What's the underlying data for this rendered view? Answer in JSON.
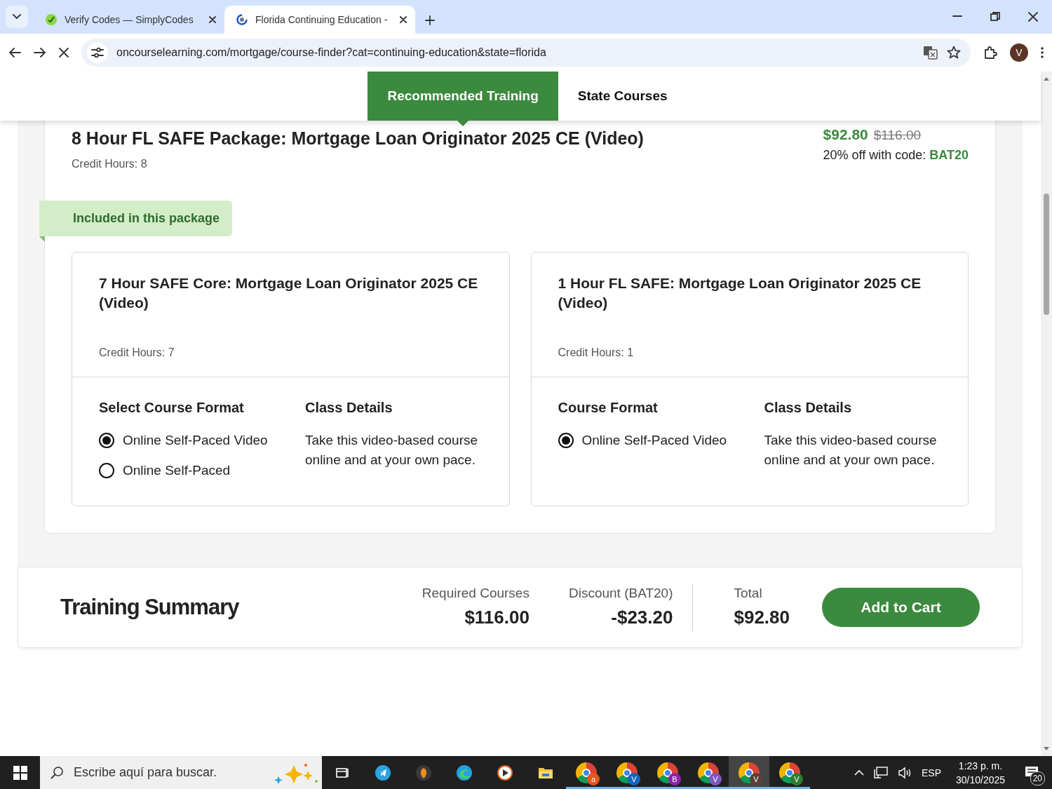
{
  "browser": {
    "tabs": [
      {
        "title": "Verify Codes — SimplyCodes",
        "kind": "simplycodes",
        "selected": false
      },
      {
        "title": "Florida Continuing Education - ",
        "kind": "loading",
        "selected": true
      }
    ],
    "url": "oncourselearning.com/mortgage/course-finder?cat=continuing-education&state=florida",
    "profile_initial": "V"
  },
  "page_nav": [
    {
      "label": "Recommended Training",
      "selected": true
    },
    {
      "label": "State Courses",
      "selected": false
    }
  ],
  "package": {
    "title": "8 Hour FL SAFE Package: Mortgage Loan Originator 2025 CE (Video)",
    "credit_hours": "Credit Hours: 8",
    "price": "$92.80",
    "original_price": "$116.00",
    "discount_text": "20% off with code: **BAT20**",
    "included_label": "Included in this package",
    "courses": [
      {
        "title": "7 Hour SAFE Core: Mortgage Loan Originator 2025 CE (Video)",
        "credit_hours": "Credit Hours: 7",
        "format_heading": "Select Course Format",
        "formats": [
          {
            "label": "Online Self-Paced Video",
            "selected": true
          },
          {
            "label": "Online Self-Paced",
            "selected": false
          }
        ],
        "details_heading": "Class Details",
        "details": "Take this video-based course online and at your own pace."
      },
      {
        "title": "1 Hour FL SAFE: Mortgage Loan Originator 2025 CE (Video)",
        "credit_hours": "Credit Hours: 1",
        "format_heading": "Course Format",
        "formats": [
          {
            "label": "Online Self-Paced Video",
            "selected": true
          }
        ],
        "details_heading": "Class Details",
        "details": "Take this video-based course online and at your own pace."
      }
    ]
  },
  "summary": {
    "title": "Training Summary",
    "items": [
      {
        "label": "Required Courses",
        "value": "$116.00"
      },
      {
        "label": "Discount (BAT20)",
        "value": "-$23.20"
      },
      {
        "label": "Total",
        "value": "$92.80"
      }
    ],
    "button": "Add to Cart"
  },
  "taskbar": {
    "search_placeholder": "Escribe aquí para buscar.",
    "apps": [
      {
        "kind": "task-view",
        "running": false,
        "selected": false
      },
      {
        "kind": "telegram",
        "running": false,
        "selected": false
      },
      {
        "kind": "fl-studio",
        "running": false,
        "selected": false
      },
      {
        "kind": "edge",
        "running": false,
        "selected": false
      },
      {
        "kind": "media-player",
        "running": false,
        "selected": false
      },
      {
        "kind": "file-explorer",
        "running": false,
        "selected": false
      },
      {
        "kind": "chrome",
        "badge": "a",
        "color": "#e8541a",
        "running": true,
        "selected": false
      },
      {
        "kind": "chrome",
        "badge": "V",
        "color": "#1565c0",
        "running": true,
        "selected": false
      },
      {
        "kind": "chrome",
        "badge": "B",
        "color": "#8e24aa",
        "running": true,
        "selected": false
      },
      {
        "kind": "chrome",
        "badge": "V",
        "color": "#7e57c2",
        "running": true,
        "selected": false
      },
      {
        "kind": "chrome",
        "badge": "V",
        "color": "#5d4037",
        "running": true,
        "selected": true
      },
      {
        "kind": "chrome",
        "badge": "V",
        "color": "#2e7d32",
        "running": true,
        "selected": false
      }
    ],
    "language": "ESP",
    "time": "1:23 p. m.",
    "date": "30/10/2025",
    "notifications": "20"
  }
}
